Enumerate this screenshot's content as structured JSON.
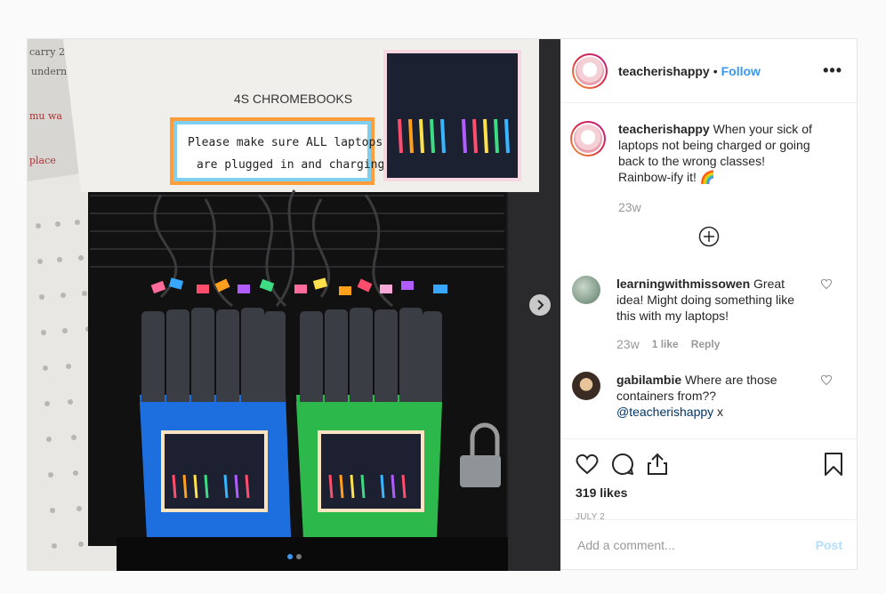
{
  "photo": {
    "sign_title": "4S CHROMEBOOKS",
    "sign_line1": "Please make sure ALL laptops",
    "sign_line2": "are plugged in and charging",
    "slide_count": 2,
    "active_slide": 1
  },
  "header": {
    "username": "teacherishappy",
    "separator": "•",
    "follow_label": "Follow",
    "more_label": "•••"
  },
  "caption": {
    "username": "teacherishappy",
    "text": "When your sick of laptops not being charged or going back to the wrong classes! Rainbow-ify it! 🌈",
    "time": "23w"
  },
  "comments": [
    {
      "username": "learningwithmissowen",
      "text": "Great idea! Might doing something like this with my laptops!",
      "time": "23w",
      "likes": "1 like",
      "reply": "Reply"
    },
    {
      "username": "gabilambie",
      "text": "Where are those containers from??",
      "mention": "@teacherishappy",
      "text_after": " x"
    }
  ],
  "footer": {
    "likes": "319 likes",
    "date": "JULY 2",
    "comment_placeholder": "Add a comment...",
    "post_label": "Post"
  },
  "icons": [
    "heart-icon",
    "comment-icon",
    "share-icon",
    "bookmark-icon",
    "plus-circle-icon",
    "chevron-right-icon",
    "more-icon"
  ],
  "colors": {
    "link": "#3897f0",
    "post_disabled": "#b2dffc",
    "blue_bin": "#1d6fe0",
    "green_bin": "#2cb84a"
  }
}
